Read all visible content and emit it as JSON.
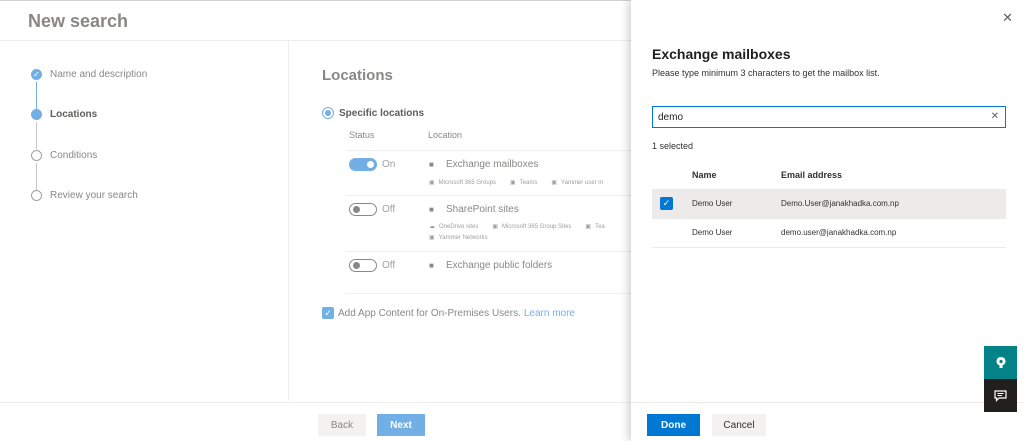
{
  "page": {
    "title": "New search"
  },
  "wizard": {
    "steps": [
      {
        "label": "Name and description",
        "state": "done"
      },
      {
        "label": "Locations",
        "state": "current"
      },
      {
        "label": "Conditions",
        "state": "todo"
      },
      {
        "label": "Review your search",
        "state": "todo"
      }
    ]
  },
  "locations": {
    "title": "Locations",
    "radio_label": "Specific locations",
    "col_status": "Status",
    "col_location": "Location",
    "rows": [
      {
        "status": "On",
        "name": "Exchange mailboxes",
        "subs": [
          "Microsoft 365 Groups",
          "Teams",
          "Yammer user m"
        ]
      },
      {
        "status": "Off",
        "name": "SharePoint sites",
        "subs": [
          "OneDrive sites",
          "Microsoft 365 Group Sites",
          "Tea",
          "Yammer Networks"
        ]
      },
      {
        "status": "Off",
        "name": "Exchange public folders",
        "subs": []
      }
    ],
    "checkbox_label": "Add App Content for On-Premises Users.",
    "learn_more": "Learn more"
  },
  "footer": {
    "back": "Back",
    "next": "Next"
  },
  "panel": {
    "title": "Exchange mailboxes",
    "subtitle": "Please type minimum 3 characters to get the mailbox list.",
    "search_value": "demo",
    "selected_count": "1 selected",
    "col_name": "Name",
    "col_email": "Email address",
    "rows": [
      {
        "name": "Demo User",
        "email": "Demo.User@janakhadka.com.np",
        "selected": true
      },
      {
        "name": "Demo User",
        "email": "demo.user@janakhadka.com.np",
        "selected": false
      }
    ],
    "done": "Done",
    "cancel": "Cancel"
  },
  "icons": {
    "close": "close-icon",
    "clear": "clear-icon",
    "help": "help-icon",
    "feedback": "feedback-icon"
  },
  "colors": {
    "accent": "#0078d4",
    "accent_dim": "#71afe5",
    "help_btn": "#038387",
    "feedback_btn": "#201f1e"
  }
}
